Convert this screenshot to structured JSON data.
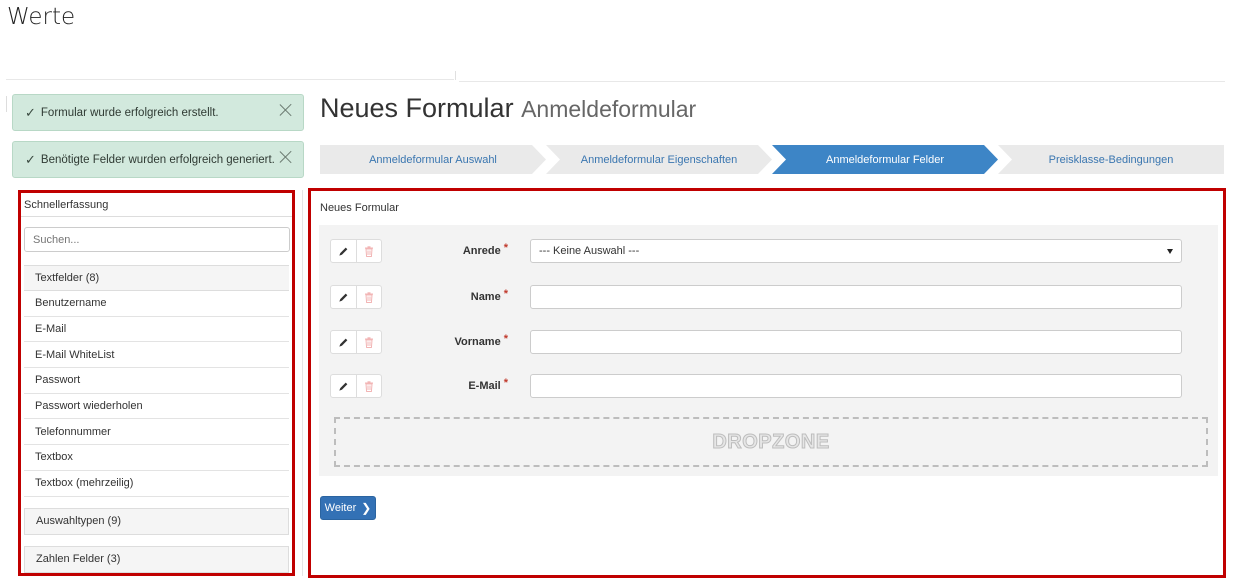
{
  "page": {
    "heading": "Werte"
  },
  "alerts": [
    {
      "text": "Formular wurde erfolgreich erstellt."
    },
    {
      "text": "Benötigte Felder wurden erfolgreich generiert."
    }
  ],
  "form_header": {
    "title": "Neues Formular",
    "subtitle": "Anmeldeformular"
  },
  "wizard": {
    "steps": [
      {
        "label": "Anmeldeformular Auswahl",
        "active": false
      },
      {
        "label": "Anmeldeformular Eigenschaften",
        "active": false
      },
      {
        "label": "Anmeldeformular Felder",
        "active": true
      },
      {
        "label": "Preisklasse-Bedingungen",
        "active": false
      }
    ]
  },
  "sidebar": {
    "title": "Schnellerfassung",
    "search_placeholder": "Suchen...",
    "groups": [
      {
        "label": "Textfelder (8)",
        "items": [
          "Benutzername",
          "E-Mail",
          "E-Mail WhiteList",
          "Passwort",
          "Passwort wiederholen",
          "Telefonnummer",
          "Textbox",
          "Textbox (mehrzeilig)"
        ]
      },
      {
        "label": "Auswahltypen (9)"
      },
      {
        "label": "Zahlen Felder (3)"
      }
    ]
  },
  "main": {
    "panel_title": "Neues Formular",
    "required_mark": "*",
    "fields": [
      {
        "label": "Anrede",
        "type": "select",
        "value": "--- Keine Auswahl ---"
      },
      {
        "label": "Name",
        "type": "text",
        "value": ""
      },
      {
        "label": "Vorname",
        "type": "text",
        "value": ""
      },
      {
        "label": "E-Mail",
        "type": "text",
        "value": ""
      }
    ],
    "dropzone_label": "DROPZONE",
    "next_button": "Weiter"
  },
  "colors": {
    "highlight_border": "#c00000",
    "active_step": "#3d85c6",
    "primary_button": "#3371b5",
    "alert_bg": "#d2e9dd",
    "required": "#c0392b"
  },
  "icons": {
    "alert_icon": "checkmark-icon",
    "alert_close": "close-icon",
    "edit": "pencil-icon",
    "delete": "trash-icon",
    "next": "chevron-right-icon",
    "select": "caret-down-icon"
  }
}
